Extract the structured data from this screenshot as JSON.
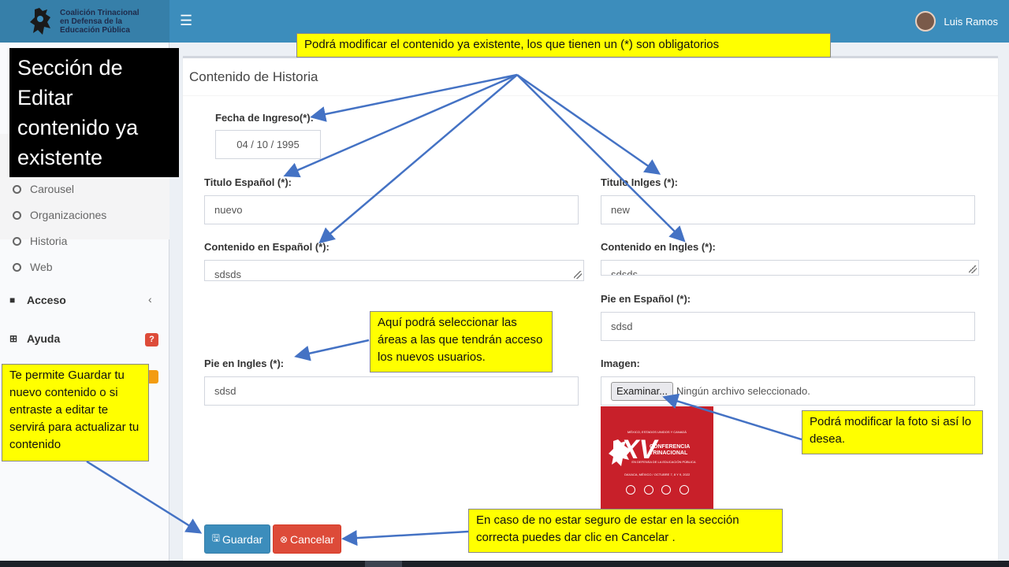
{
  "header": {
    "org_line1": "Coalición Trinacional",
    "org_line2": "en Defensa de la",
    "org_line3": "Educación Pública",
    "menu_icon": "hamburger-icon",
    "user_name": "Luis Ramos"
  },
  "sidebar": {
    "sub_items": [
      {
        "label": "Carousel"
      },
      {
        "label": "Organizaciones"
      },
      {
        "label": "Historia"
      },
      {
        "label": "Web"
      }
    ],
    "acceso": "Acceso",
    "acceso_chevron": "‹",
    "ayuda": "Ayuda",
    "ayuda_badge": "?"
  },
  "form": {
    "box_title": "Contenido de Historia",
    "fecha_label": "Fecha de Ingreso(*):",
    "fecha_value": "04 / 10 / 1995",
    "titulo_es_label": "Titulo Español (*):",
    "titulo_es_value": "nuevo",
    "titulo_en_label": "Titulo Inlges (*):",
    "titulo_en_value": "new",
    "contenido_es_label": "Contenido en Español (*):",
    "contenido_es_value": "sdsds",
    "contenido_en_label": "Contenido en Ingles (*):",
    "contenido_en_value": "sdsds",
    "pie_es_label": "Pie en Español (*):",
    "pie_es_value": "sdsd",
    "pie_en_label": "Pie en Ingles (*):",
    "pie_en_value": "sdsd",
    "imagen_label": "Imagen:",
    "file_button": "Examinar...",
    "file_status": "Ningún archivo seleccionado.",
    "poster": {
      "top_text": "MÉXICO, ESTADOS UNIDOS Y CANADÁ",
      "numeral": "XV",
      "line1": "CONFERENCIA",
      "line2": "TRINACIONAL",
      "line3": "EN DEFENSA DE LA EDUCACIÓN PÚBLICA",
      "bottom_text": "OAXACA, MÉXICO / OCTUBRE 7, 8 Y 9, 2022"
    },
    "save_label": "Guardar",
    "cancel_label": "Cancelar"
  },
  "callouts": {
    "title": "Sección de\nEditar\ncontenido ya\nexistente",
    "top_note": "Podrá modificar el contenido ya existente, los que tienen un (*) son obligatorios",
    "areas_note": "Aquí podrá seleccionar las áreas a las que tendrán acceso los nuevos usuarios.",
    "guardar_note": "Te permite Guardar tu nuevo contenido o si entraste a editar te servirá para actualizar tu contenido",
    "foto_note": "Podrá modificar la foto si así lo desea.",
    "cancel_note": "En caso de no estar seguro de estar en la sección correcta puedes dar clic en Cancelar ."
  },
  "colors": {
    "header": "#3c8dbc",
    "callout_yellow": "#ffff00",
    "arrow_blue": "#4472c4",
    "save_button": "#3c8dbc",
    "cancel_button": "#dd4b39"
  }
}
